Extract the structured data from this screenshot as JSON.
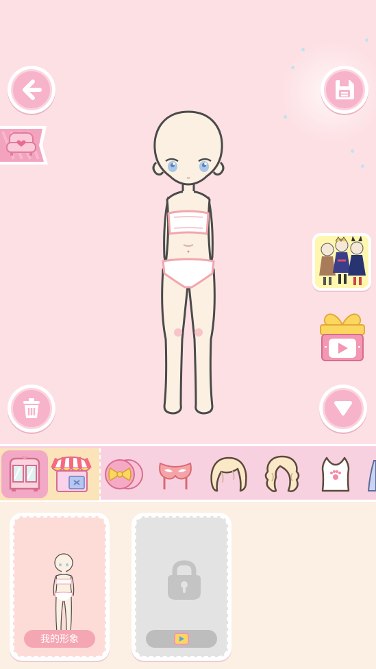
{
  "stage": {
    "buttons": {
      "back": "arrow-left-icon",
      "save": "floppy-disk-icon",
      "delete": "trash-icon",
      "collapse": "triangle-down-icon"
    },
    "side_items": {
      "sofa_tab": "sofa-heart-icon",
      "ad_thumbnail": "outfit-preview-thumbnail",
      "gift_video": "gift-video-icon"
    }
  },
  "tabbar": {
    "tabs": [
      {
        "icon": "wardrobe-icon",
        "active": true
      },
      {
        "icon": "shop-icon",
        "active": false
      },
      {
        "icon": "bow-candy-icon",
        "active": false
      },
      {
        "icon": "mask-icon",
        "active": false
      },
      {
        "icon": "short-hair-icon",
        "active": false
      },
      {
        "icon": "wavy-hair-icon",
        "active": false
      },
      {
        "icon": "tank-top-icon",
        "active": false
      }
    ]
  },
  "drawer": {
    "cards": [
      {
        "label": "我的形象",
        "locked": false
      },
      {
        "label": "",
        "locked": true,
        "icon": "lock-icon",
        "badge": "video-play-icon"
      }
    ]
  },
  "colors": {
    "background": "#fde0e4",
    "button_pink": "#f7b3c9",
    "tabbar": "#f8d1e1",
    "drawer": "#fcefe3",
    "skin": "#fbf0e1",
    "outline": "#4a4a4a"
  }
}
